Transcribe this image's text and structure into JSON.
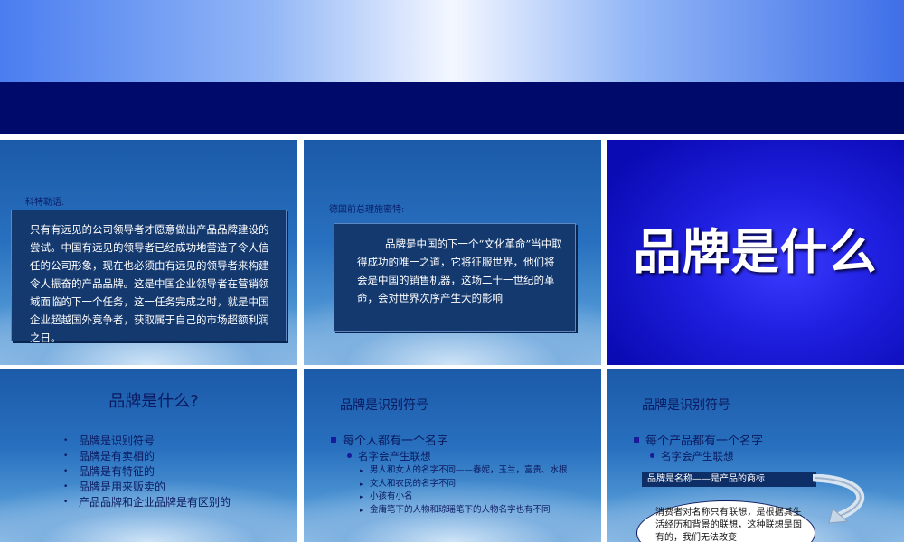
{
  "slide1": {
    "speaker": "科特勒语:",
    "quote": "只有有远见的公司领导者才愿意做出产品品牌建设的尝试。中国有远见的领导者已经成功地营造了令人信任的公司形象，现在也必须由有远见的领导者来构建令人振奋的产品品牌。这是中国企业领导者在营销领域面临的下一个任务，这一任务完成之时，就是中国企业超越国外竞争者，获取属于自己的市场超额利润之日。"
  },
  "slide2": {
    "speaker": "德国前总理施密特:",
    "quote": "品牌是中国的下一个“文化革命”当中取得成功的唯一之道，它将征服世界，他们将会是中国的销售机器，这场二十一世纪的革命，会对世界次序产生大的影响"
  },
  "slide3": {
    "title": "品牌是什么"
  },
  "slide4": {
    "title": "品牌是什么?",
    "bullets": [
      "品牌是识别符号",
      "品牌是有卖相的",
      "品牌是有特征的",
      "品牌是用来贩卖的",
      "产品品牌和企业品牌是有区别的"
    ]
  },
  "slide5": {
    "title": "品牌是识别符号",
    "level1": "每个人都有一个名字",
    "level2": "名字会产生联想",
    "level3": [
      "男人和女人的名字不同——春妮，玉兰，富贵、水根",
      "文人和农民的名字不同",
      "小孩有小名",
      "金庸笔下的人物和琼瑶笔下的人物名字也有不同"
    ]
  },
  "slide6": {
    "title": "品牌是识别符号",
    "level1": "每个产品都有一个名字",
    "level2": "名字会产生联想",
    "label": "品牌是名称——是产品的商标",
    "ellipse_text": "消费者对名称只有联想，是根据其生活经历和背景的联想，这种联想是固有的，我们无法改变"
  }
}
